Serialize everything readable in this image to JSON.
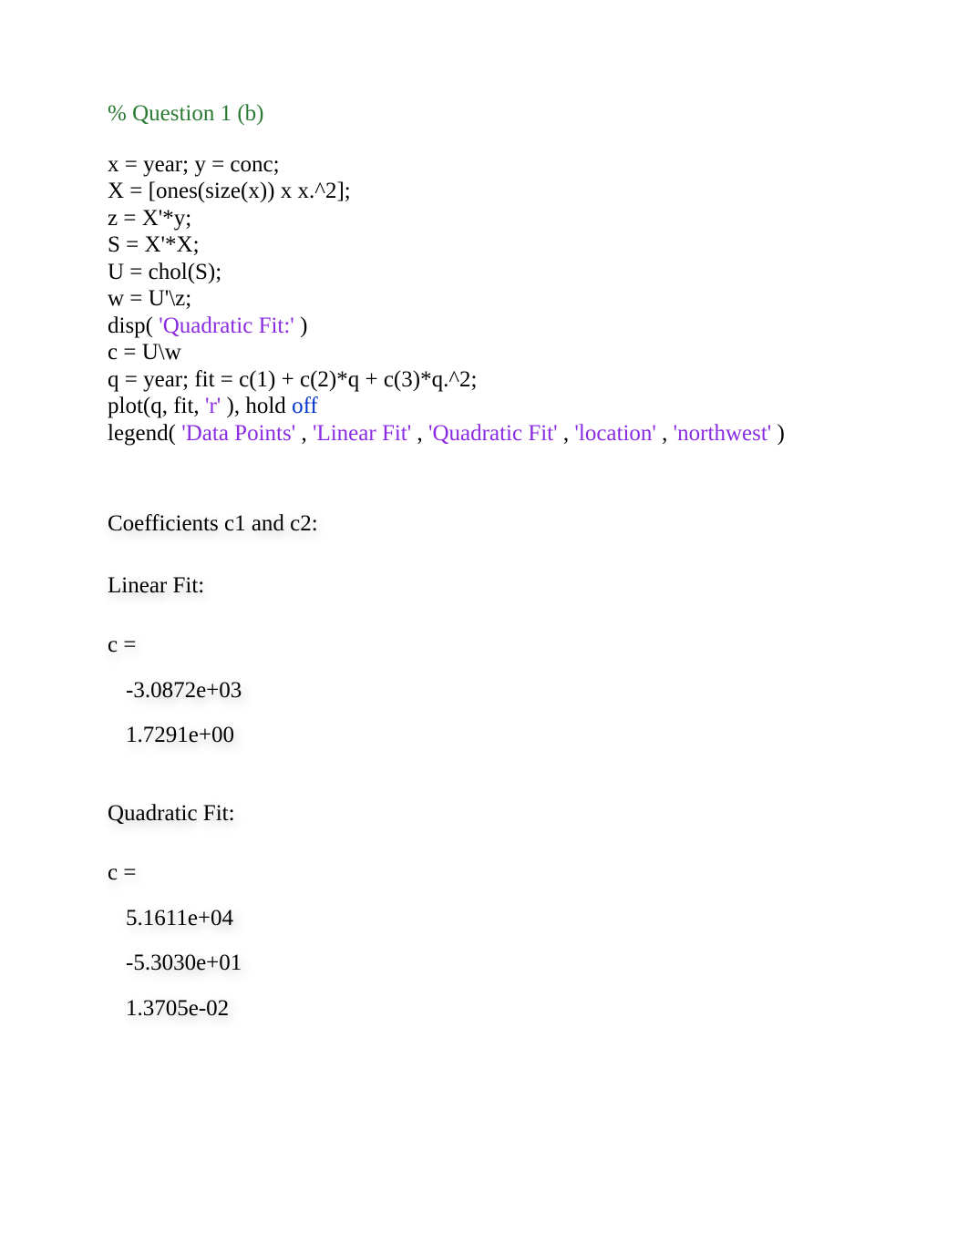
{
  "code": {
    "comment": "% Question 1 (b)",
    "l1": "x = year; y = conc;",
    "l2": "X = [ones(size(x)) x x.^2];",
    "l3": "z = X'*y;",
    "l4": "S = X'*X;",
    "l5": "U = chol(S);",
    "l6": "w = U'\\z;",
    "l7_pre": "disp(",
    "l7_str": "'Quadratic Fit:'",
    "l7_post": ")",
    "l8": "c = U\\w",
    "l9": "q = year; fit = c(1) + c(2)*q + c(3)*q.^2;",
    "l10_pre": "plot(q, fit, ",
    "l10_str": "'r'",
    "l10_mid": "), hold ",
    "l10_kw": "off",
    "l11_pre": "legend(",
    "l11_s1": "'Data Points'",
    "l11_c1": ", ",
    "l11_s2": "'Linear Fit'",
    "l11_c2": ", ",
    "l11_s3": "'Quadratic Fit'",
    "l11_c3": ", ",
    "l11_s4": "'location'",
    "l11_c4": ", ",
    "l11_s5": "'northwest'",
    "l11_post": ")"
  },
  "output": {
    "coeff_heading": "Coefficients c1 and c2:",
    "linear_heading": "Linear Fit:",
    "c_label": "c =",
    "linear_vals": {
      "v1": "-3.0872e+03",
      "v2": " 1.7291e+00"
    },
    "quad_heading": "Quadratic Fit:",
    "quad_vals": {
      "v1": " 5.1611e+04",
      "v2": "-5.3030e+01",
      "v3": " 1.3705e-02"
    }
  }
}
